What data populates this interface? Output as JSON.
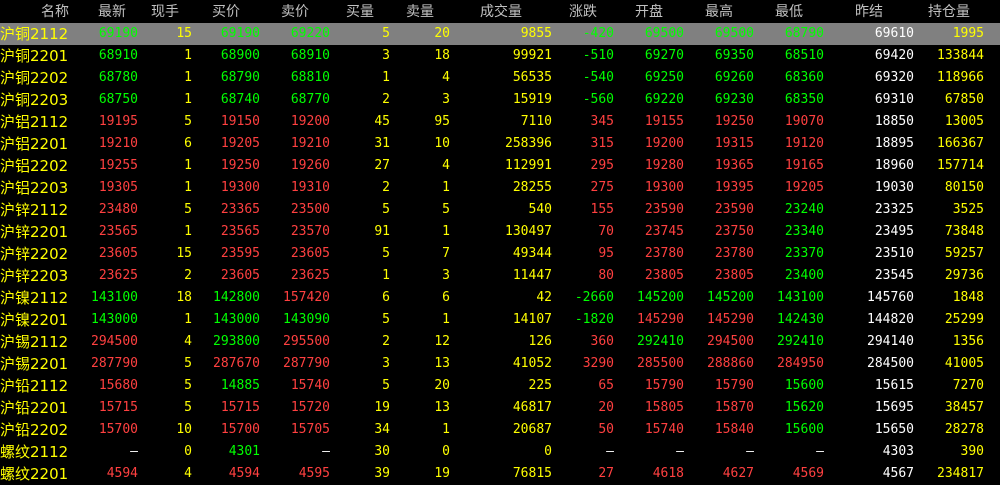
{
  "colors": {
    "background": "#000000",
    "selected_row": "#808080",
    "header": "#c0c0c0",
    "up": "#ff4040",
    "down": "#00ff00",
    "neutral": "#ffffff",
    "yellow": "#ffff00"
  },
  "header": {
    "name": "名称",
    "last": "最新",
    "hand": "现手",
    "bid": "买价",
    "ask": "卖价",
    "bid_vol": "买量",
    "ask_vol": "卖量",
    "volume": "成交量",
    "change": "涨跌",
    "open": "开盘",
    "high": "最高",
    "low": "最低",
    "prev_settle": "昨结",
    "open_interest": "持仓量"
  },
  "rows": [
    {
      "name": "沪铜2112",
      "last": "69190",
      "hand": "15",
      "bid": "69190",
      "ask": "69220",
      "bid_vol": "5",
      "ask_vol": "20",
      "volume": "9855",
      "change": "-420",
      "open": "69500",
      "high": "69500",
      "low": "68790",
      "prev_settle": "69610",
      "open_interest": "1995",
      "direction": "down"
    },
    {
      "name": "沪铜2201",
      "last": "68910",
      "hand": "1",
      "bid": "68900",
      "ask": "68910",
      "bid_vol": "3",
      "ask_vol": "18",
      "volume": "99921",
      "change": "-510",
      "open": "69270",
      "high": "69350",
      "low": "68510",
      "prev_settle": "69420",
      "open_interest": "133844",
      "direction": "down"
    },
    {
      "name": "沪铜2202",
      "last": "68780",
      "hand": "1",
      "bid": "68790",
      "ask": "68810",
      "bid_vol": "1",
      "ask_vol": "4",
      "volume": "56535",
      "change": "-540",
      "open": "69250",
      "high": "69260",
      "low": "68360",
      "prev_settle": "69320",
      "open_interest": "118966",
      "direction": "down"
    },
    {
      "name": "沪铜2203",
      "last": "68750",
      "hand": "1",
      "bid": "68740",
      "ask": "68770",
      "bid_vol": "2",
      "ask_vol": "3",
      "volume": "15919",
      "change": "-560",
      "open": "69220",
      "high": "69230",
      "low": "68350",
      "prev_settle": "69310",
      "open_interest": "67850",
      "direction": "down"
    },
    {
      "name": "沪铝2112",
      "last": "19195",
      "hand": "5",
      "bid": "19150",
      "ask": "19200",
      "bid_vol": "45",
      "ask_vol": "95",
      "volume": "7110",
      "change": "345",
      "open": "19155",
      "high": "19250",
      "low": "19070",
      "prev_settle": "18850",
      "open_interest": "13005",
      "direction": "up"
    },
    {
      "name": "沪铝2201",
      "last": "19210",
      "hand": "6",
      "bid": "19205",
      "ask": "19210",
      "bid_vol": "31",
      "ask_vol": "10",
      "volume": "258396",
      "change": "315",
      "open": "19200",
      "high": "19315",
      "low": "19120",
      "prev_settle": "18895",
      "open_interest": "166367",
      "direction": "up"
    },
    {
      "name": "沪铝2202",
      "last": "19255",
      "hand": "1",
      "bid": "19250",
      "ask": "19260",
      "bid_vol": "27",
      "ask_vol": "4",
      "volume": "112991",
      "change": "295",
      "open": "19280",
      "high": "19365",
      "low": "19165",
      "prev_settle": "18960",
      "open_interest": "157714",
      "direction": "up"
    },
    {
      "name": "沪铝2203",
      "last": "19305",
      "hand": "1",
      "bid": "19300",
      "ask": "19310",
      "bid_vol": "2",
      "ask_vol": "1",
      "volume": "28255",
      "change": "275",
      "open": "19300",
      "high": "19395",
      "low": "19205",
      "prev_settle": "19030",
      "open_interest": "80150",
      "direction": "up"
    },
    {
      "name": "沪锌2112",
      "last": "23480",
      "hand": "5",
      "bid": "23365",
      "ask": "23500",
      "bid_vol": "5",
      "ask_vol": "5",
      "volume": "540",
      "change": "155",
      "open": "23590",
      "high": "23590",
      "low": "23240",
      "prev_settle": "23325",
      "open_interest": "3525",
      "direction": "up"
    },
    {
      "name": "沪锌2201",
      "last": "23565",
      "hand": "1",
      "bid": "23565",
      "ask": "23570",
      "bid_vol": "91",
      "ask_vol": "1",
      "volume": "130497",
      "change": "70",
      "open": "23745",
      "high": "23750",
      "low": "23340",
      "prev_settle": "23495",
      "open_interest": "73848",
      "direction": "up"
    },
    {
      "name": "沪锌2202",
      "last": "23605",
      "hand": "15",
      "bid": "23595",
      "ask": "23605",
      "bid_vol": "5",
      "ask_vol": "7",
      "volume": "49344",
      "change": "95",
      "open": "23780",
      "high": "23780",
      "low": "23370",
      "prev_settle": "23510",
      "open_interest": "59257",
      "direction": "up"
    },
    {
      "name": "沪锌2203",
      "last": "23625",
      "hand": "2",
      "bid": "23605",
      "ask": "23625",
      "bid_vol": "1",
      "ask_vol": "3",
      "volume": "11447",
      "change": "80",
      "open": "23805",
      "high": "23805",
      "low": "23400",
      "prev_settle": "23545",
      "open_interest": "29736",
      "direction": "up"
    },
    {
      "name": "沪镍2112",
      "last": "143100",
      "hand": "18",
      "bid": "142800",
      "ask": "157420",
      "bid_vol": "6",
      "ask_vol": "6",
      "volume": "42",
      "change": "-2660",
      "open": "145200",
      "high": "145200",
      "low": "143100",
      "prev_settle": "145760",
      "open_interest": "1848",
      "direction": "down"
    },
    {
      "name": "沪镍2201",
      "last": "143000",
      "hand": "1",
      "bid": "143000",
      "ask": "143090",
      "bid_vol": "5",
      "ask_vol": "1",
      "volume": "14107",
      "change": "-1820",
      "open": "145290",
      "high": "145290",
      "low": "142430",
      "prev_settle": "144820",
      "open_interest": "25299",
      "direction": "down"
    },
    {
      "name": "沪锡2112",
      "last": "294500",
      "hand": "4",
      "bid": "293800",
      "ask": "295500",
      "bid_vol": "2",
      "ask_vol": "12",
      "volume": "126",
      "change": "360",
      "open": "292410",
      "high": "294500",
      "low": "292410",
      "prev_settle": "294140",
      "open_interest": "1356",
      "direction": "up"
    },
    {
      "name": "沪锡2201",
      "last": "287790",
      "hand": "5",
      "bid": "287670",
      "ask": "287790",
      "bid_vol": "3",
      "ask_vol": "13",
      "volume": "41052",
      "change": "3290",
      "open": "285500",
      "high": "288860",
      "low": "284950",
      "prev_settle": "284500",
      "open_interest": "41005",
      "direction": "up"
    },
    {
      "name": "沪铅2112",
      "last": "15680",
      "hand": "5",
      "bid": "14885",
      "ask": "15740",
      "bid_vol": "5",
      "ask_vol": "20",
      "volume": "225",
      "change": "65",
      "open": "15790",
      "high": "15790",
      "low": "15600",
      "prev_settle": "15615",
      "open_interest": "7270",
      "direction": "up"
    },
    {
      "name": "沪铅2201",
      "last": "15715",
      "hand": "5",
      "bid": "15715",
      "ask": "15720",
      "bid_vol": "19",
      "ask_vol": "13",
      "volume": "46817",
      "change": "20",
      "open": "15805",
      "high": "15870",
      "low": "15620",
      "prev_settle": "15695",
      "open_interest": "38457",
      "direction": "up"
    },
    {
      "name": "沪铅2202",
      "last": "15700",
      "hand": "10",
      "bid": "15700",
      "ask": "15705",
      "bid_vol": "34",
      "ask_vol": "1",
      "volume": "20687",
      "change": "50",
      "open": "15740",
      "high": "15840",
      "low": "15600",
      "prev_settle": "15650",
      "open_interest": "28278",
      "direction": "up"
    },
    {
      "name": "螺纹2112",
      "last": "—",
      "hand": "0",
      "bid": "4301",
      "ask": "—",
      "bid_vol": "30",
      "ask_vol": "0",
      "volume": "0",
      "change": "—",
      "open": "—",
      "high": "—",
      "low": "—",
      "prev_settle": "4303",
      "open_interest": "390",
      "direction": "none"
    },
    {
      "name": "螺纹2201",
      "last": "4594",
      "hand": "4",
      "bid": "4594",
      "ask": "4595",
      "bid_vol": "39",
      "ask_vol": "19",
      "volume": "76815",
      "change": "27",
      "open": "4618",
      "high": "4627",
      "low": "4569",
      "prev_settle": "4567",
      "open_interest": "234817",
      "direction": "up"
    }
  ]
}
